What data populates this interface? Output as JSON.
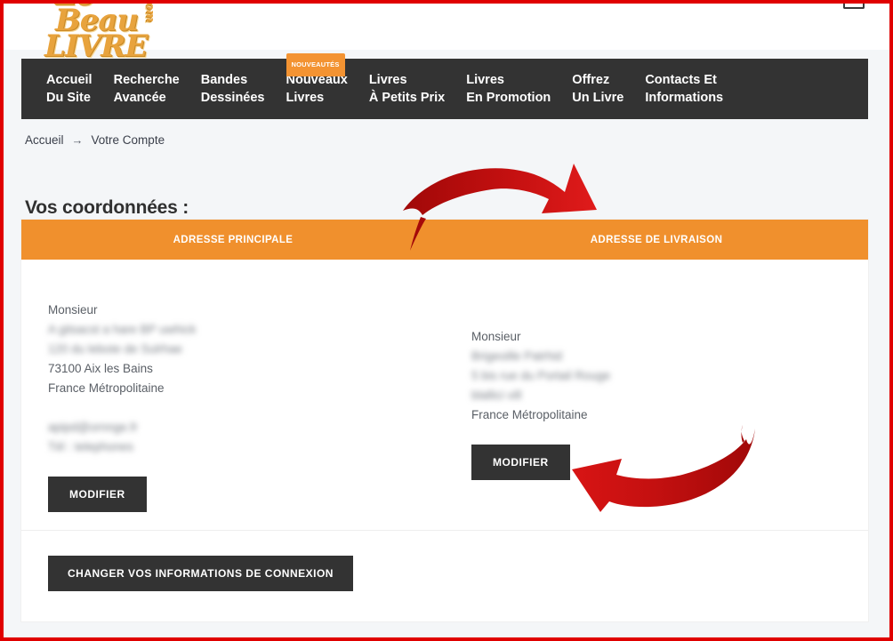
{
  "header": {
    "logo_line1": "Le Beau",
    "logo_line2": "LIVRE",
    "logo_suffix": ".com",
    "cart_icon": "shopping-cart-icon"
  },
  "nav": {
    "items": [
      {
        "line1": "Accueil",
        "line2": "Du Site",
        "badge": null
      },
      {
        "line1": "Recherche",
        "line2": "Avancée",
        "badge": null
      },
      {
        "line1": "Bandes",
        "line2": "Dessinées",
        "badge": null
      },
      {
        "line1": "Nouveaux",
        "line2": "Livres",
        "badge": "NOUVEAUTÉS"
      },
      {
        "line1": "Livres",
        "line2": "À Petits Prix",
        "badge": null
      },
      {
        "line1": "Livres",
        "line2": "En Promotion",
        "badge": null
      },
      {
        "line1": "Offrez",
        "line2": "Un Livre",
        "badge": null
      },
      {
        "line1": "Contacts Et",
        "line2": "Informations",
        "badge": null
      }
    ]
  },
  "breadcrumb": {
    "home": "Accueil",
    "separator": "→",
    "current": "Votre Compte"
  },
  "main": {
    "title": "Vos coordonnées :",
    "tabs": [
      {
        "label": "ADRESSE PRINCIPALE"
      },
      {
        "label": "ADRESSE DE LIVRAISON"
      }
    ],
    "address_principale": {
      "civility": "Monsieur",
      "name_blurred": "A gitsacst a hare BP uwhick",
      "street_blurred": "120 du  lebote de Sulrhae",
      "postal_city": "73100 Aix les Bains",
      "country": "France Métropolitaine",
      "email_blurred": "apipd@ornnge.fr",
      "phone_blurred": "Tél : telephones",
      "edit_label": "MODIFIER"
    },
    "address_livraison": {
      "civility": "Monsieur",
      "name_blurred": "Brigeoille Patrhid",
      "street_blurred": "5 bis rue du Portail Rouge",
      "city_blurred": "blallici vill",
      "country": "France Métropolitaine",
      "edit_label": "MODIFIER"
    },
    "footer_button": "CHANGER VOS INFORMATIONS DE CONNEXION"
  },
  "annotations": {
    "arrow_top": "red-curved-arrow-right",
    "arrow_bottom": "red-curved-arrow-left",
    "arrow_color": "#c10d0d"
  },
  "colors": {
    "accent_orange": "#f0902d",
    "nav_dark": "#333333",
    "page_bg": "#f4f6f8",
    "border_red": "#e00000"
  }
}
